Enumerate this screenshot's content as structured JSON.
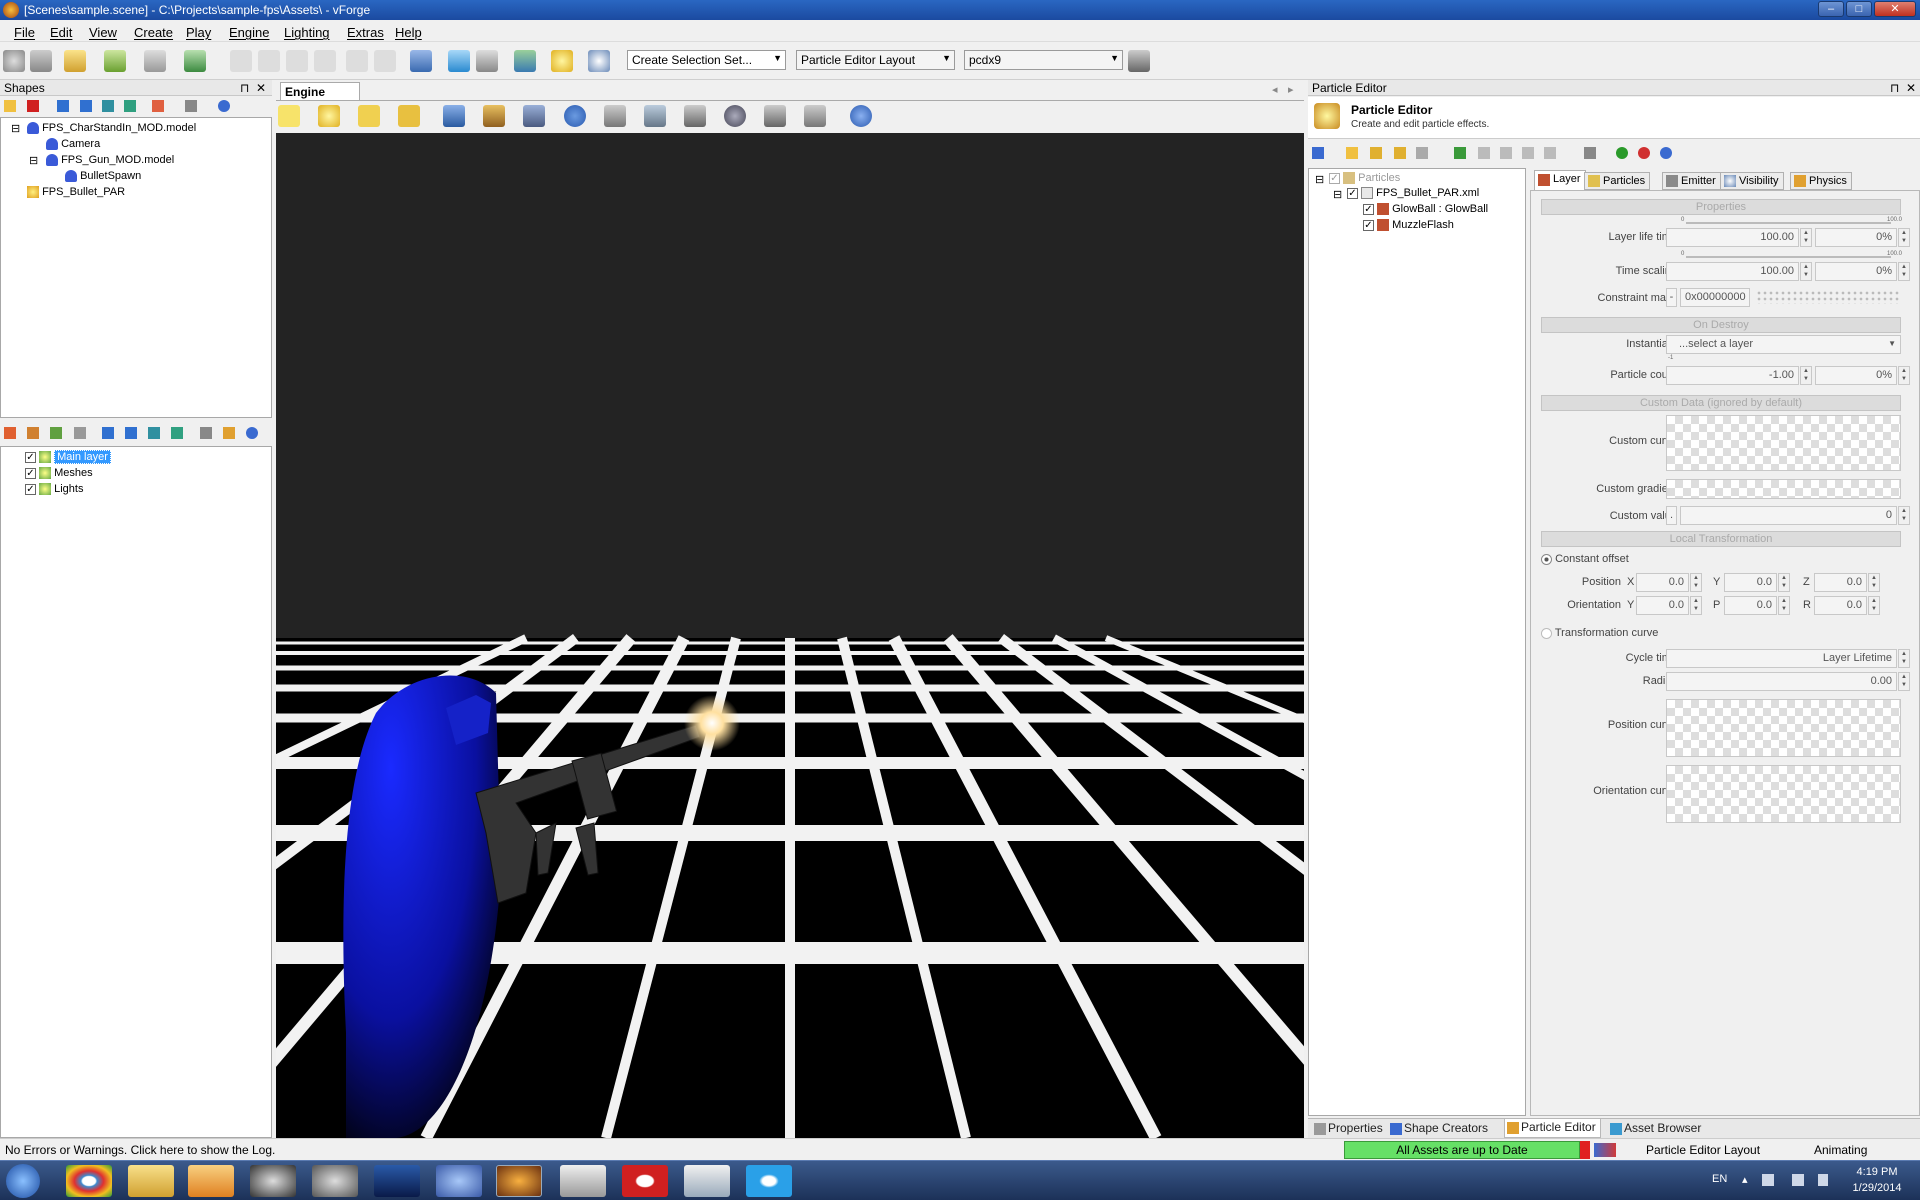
{
  "window": {
    "title": "[Scenes\\sample.scene] - C:\\Projects\\sample-fps\\Assets\\ - vForge",
    "min": "‒",
    "max": "□",
    "close": "✕"
  },
  "menu": [
    "File",
    "Edit",
    "View",
    "Create",
    "Play",
    "Engine",
    "Lighting",
    "Extras",
    "Help"
  ],
  "toolbar": {
    "selection_set": "Create Selection Set...",
    "layout": "Particle Editor Layout",
    "platform": "pcdx9"
  },
  "shapes": {
    "title": "Shapes",
    "pin": "⊓",
    "close": "✕",
    "tree": [
      {
        "label": "FPS_CharStandIn_MOD.model",
        "toggle": "⊟"
      },
      {
        "label": "Camera"
      },
      {
        "label": "FPS_Gun_MOD.model",
        "toggle": "⊟"
      },
      {
        "label": "BulletSpawn"
      },
      {
        "label": "FPS_Bullet_PAR"
      }
    ]
  },
  "layers": {
    "items": [
      {
        "label": "Main layer",
        "checked": "✓"
      },
      {
        "label": "Meshes",
        "checked": "✓"
      },
      {
        "label": "Lights",
        "checked": "✓"
      }
    ]
  },
  "engine_view": {
    "tab": "Engine View",
    "prev": "◂",
    "next": "▸"
  },
  "particle_editor": {
    "panel_title": "Particle Editor",
    "header_title": "Particle Editor",
    "header_sub": "Create and edit particle effects.",
    "tree": {
      "root": "Particles",
      "file": "FPS_Bullet_PAR.xml",
      "layers": [
        "GlowBall : GlowBall",
        "MuzzleFlash"
      ]
    },
    "tabs": [
      "Layer",
      "Particles",
      "Emitter",
      "Visibility",
      "Physics"
    ],
    "sections": {
      "properties": "Properties",
      "on_destroy": "On Destroy",
      "custom_data": "Custom Data (ignored by default)",
      "local_transform": "Local Transformation"
    },
    "fields": {
      "layer_life_time": {
        "label": "Layer life time",
        "value": "100.00",
        "pct": "0%",
        "min": "0",
        "max": "100.0"
      },
      "time_scaling": {
        "label": "Time scaling",
        "value": "100.00",
        "pct": "0%",
        "min": "0",
        "max": "100.0"
      },
      "constraint_mask": {
        "label": "Constraint mask",
        "value": "0x00000000",
        "btn": "-"
      },
      "instantiate": {
        "label": "Instantiate",
        "value": "...select a layer",
        "sub": "-1"
      },
      "particle_count": {
        "label": "Particle count",
        "value": "-1.00",
        "pct": "0%"
      },
      "custom_curve": "Custom curve",
      "custom_gradient": "Custom gradient",
      "custom_value": {
        "label": "Custom value",
        "value": "0",
        "btn": "."
      },
      "constant_offset": "Constant offset",
      "position": {
        "label": "Position",
        "x": "0.0",
        "y": "0.0",
        "z": "0.0"
      },
      "orientation": {
        "label": "Orientation",
        "y": "0.0",
        "p": "0.0",
        "r": "0.0"
      },
      "axes": {
        "x": "X",
        "y": "Y",
        "z": "Z",
        "oy": "Y",
        "op": "P",
        "or": "R"
      },
      "transformation_curve": "Transformation curve",
      "cycle_time": {
        "label": "Cycle time",
        "value": "Layer Lifetime"
      },
      "radius": {
        "label": "Radius",
        "value": "0.00"
      },
      "position_curve": "Position curve",
      "orientation_curve": "Orientation curve"
    }
  },
  "bottom_tabs": [
    "Properties",
    "Shape Creators",
    "Particle Editor",
    "Asset Browser"
  ],
  "status": {
    "log": "No Errors or Warnings. Click here to show the Log.",
    "assets": "All Assets are up to Date",
    "layout": "Particle Editor Layout",
    "mode": "Animating"
  },
  "taskbar": {
    "lang": "EN",
    "time": "4:19 PM",
    "date": "1/29/2014"
  }
}
